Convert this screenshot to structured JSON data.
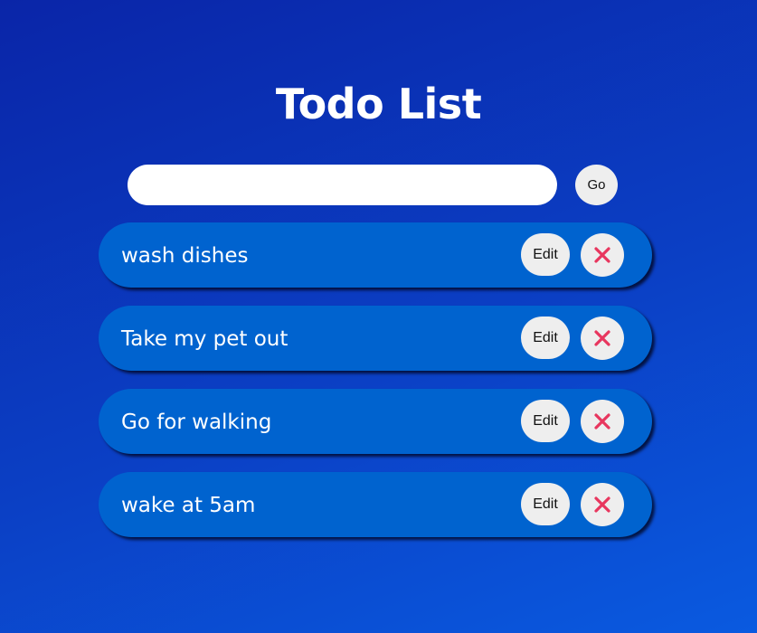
{
  "header": {
    "title": "Todo List"
  },
  "input": {
    "value": "",
    "placeholder": "",
    "submit_label": "Go"
  },
  "todos": [
    {
      "text": "wash dishes",
      "edit_label": "Edit",
      "delete_icon": "close-icon"
    },
    {
      "text": "Take my pet out",
      "edit_label": "Edit",
      "delete_icon": "close-icon"
    },
    {
      "text": "Go for walking",
      "edit_label": "Edit",
      "delete_icon": "close-icon"
    },
    {
      "text": "wake at 5am",
      "edit_label": "Edit",
      "delete_icon": "close-icon"
    }
  ],
  "colors": {
    "background_top": "#0a25a8",
    "background_bottom": "#0a5ae0",
    "item_background": "#0063cf",
    "button_background": "#eeeeee",
    "delete_icon": "#e8365e"
  }
}
